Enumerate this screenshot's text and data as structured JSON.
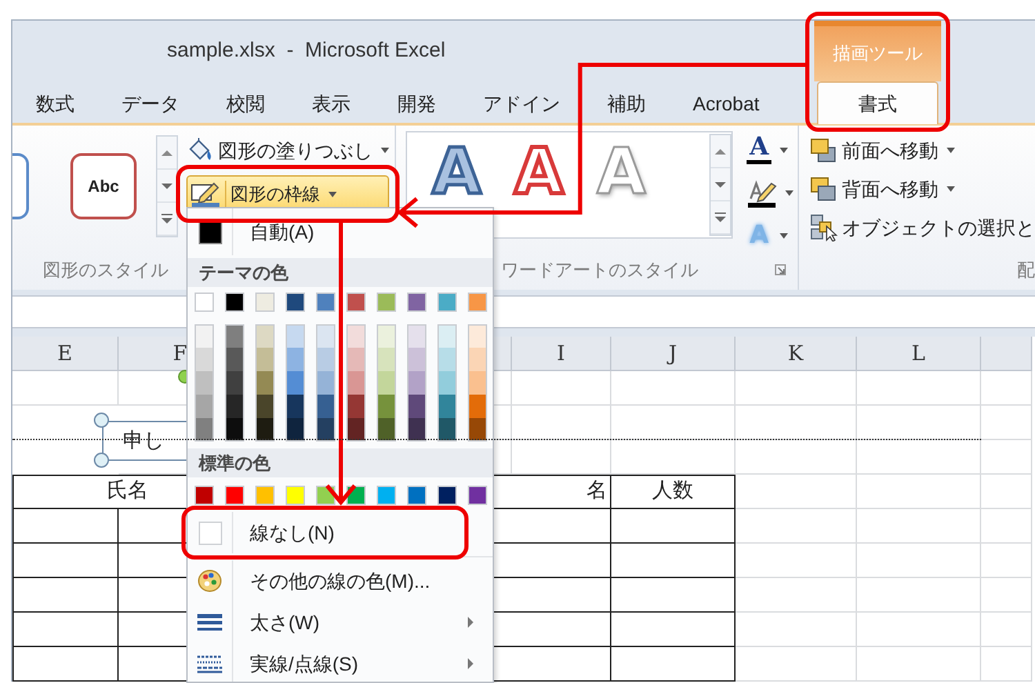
{
  "window": {
    "title": "sample.xlsx  -  Microsoft Excel"
  },
  "context_group": {
    "label": "描画ツール",
    "annotated": true
  },
  "tabs": [
    {
      "label": "数式",
      "selected": false,
      "kind": "standard"
    },
    {
      "label": "データ",
      "selected": false,
      "kind": "standard"
    },
    {
      "label": "校閲",
      "selected": false,
      "kind": "standard"
    },
    {
      "label": "表示",
      "selected": false,
      "kind": "standard"
    },
    {
      "label": "開発",
      "selected": false,
      "kind": "standard"
    },
    {
      "label": "アドイン",
      "selected": false,
      "kind": "standard"
    },
    {
      "label": "補助",
      "selected": false,
      "kind": "standard"
    },
    {
      "label": "Acrobat",
      "selected": false,
      "kind": "standard"
    },
    {
      "label": "書式",
      "selected": true,
      "kind": "contextual"
    }
  ],
  "ribbon": {
    "shape_styles": {
      "label": "図形のスタイル",
      "samples": [
        {
          "kind": "partial"
        },
        {
          "kind": "red",
          "text": "Abc"
        }
      ]
    },
    "shape_fill": {
      "label": "図形の塗りつぶし"
    },
    "shape_outline": {
      "label": "図形の枠線",
      "selected": true,
      "annotated": true
    },
    "wordart": {
      "label": "ワードアートのスタイル",
      "samples": [
        {
          "kind": "blue-outline",
          "text": "A"
        },
        {
          "kind": "red-outline",
          "text": "A"
        },
        {
          "kind": "white",
          "text": "A"
        }
      ],
      "text_fill": "A",
      "text_effects": "A"
    },
    "arrange": {
      "label": "配",
      "items": [
        {
          "kind": "front",
          "label": "前面へ移動",
          "dropdown": true
        },
        {
          "kind": "back",
          "label": "背面へ移動",
          "dropdown": true
        },
        {
          "kind": "select",
          "label": "オブジェクトの選択と",
          "dropdown": false
        }
      ]
    }
  },
  "sheet": {
    "columns": [
      {
        "label": "E"
      },
      {
        "label": "F"
      },
      {},
      {},
      {
        "label": "I"
      },
      {
        "label": "J"
      },
      {
        "label": "K"
      },
      {
        "label": "L"
      },
      {}
    ],
    "page_break": true,
    "table": {
      "headings": [
        {
          "text": "氏名"
        },
        {
          "text": "名"
        },
        {
          "text": "人数"
        }
      ]
    },
    "shape": {
      "text": "申し",
      "selected": true
    }
  },
  "menu": {
    "automatic": {
      "label": "自動(A)",
      "color": "#000000"
    },
    "theme_header": "テーマの色",
    "theme_colors": [
      {
        "color": "#ffffff",
        "shades": [
          {
            "color": "#f2f2f2"
          },
          {
            "color": "#d9d9d9"
          },
          {
            "color": "#bfbfbf"
          },
          {
            "color": "#a6a6a6"
          },
          {
            "color": "#808080"
          }
        ]
      },
      {
        "color": "#000000",
        "shades": [
          {
            "color": "#7f7f7f"
          },
          {
            "color": "#595959"
          },
          {
            "color": "#404040"
          },
          {
            "color": "#262626"
          },
          {
            "color": "#0d0d0d"
          }
        ]
      },
      {
        "color": "#eeece1",
        "shades": [
          {
            "color": "#ddd9c3"
          },
          {
            "color": "#c4bd97"
          },
          {
            "color": "#948a54"
          },
          {
            "color": "#4a452a"
          },
          {
            "color": "#1e1c11"
          }
        ]
      },
      {
        "color": "#1f497d",
        "shades": [
          {
            "color": "#c6d9f0"
          },
          {
            "color": "#8db3e2"
          },
          {
            "color": "#548dd4"
          },
          {
            "color": "#17365d"
          },
          {
            "color": "#0f243e"
          }
        ]
      },
      {
        "color": "#4f81bd",
        "shades": [
          {
            "color": "#dbe5f1"
          },
          {
            "color": "#b8cce4"
          },
          {
            "color": "#95b3d7"
          },
          {
            "color": "#366092"
          },
          {
            "color": "#244061"
          }
        ]
      },
      {
        "color": "#c0504d",
        "shades": [
          {
            "color": "#f2dcdb"
          },
          {
            "color": "#e5b9b7"
          },
          {
            "color": "#d99694"
          },
          {
            "color": "#953734"
          },
          {
            "color": "#632423"
          }
        ]
      },
      {
        "color": "#9bbb59",
        "shades": [
          {
            "color": "#ebf1dd"
          },
          {
            "color": "#d7e3bc"
          },
          {
            "color": "#c3d69b"
          },
          {
            "color": "#76923c"
          },
          {
            "color": "#4f6128"
          }
        ]
      },
      {
        "color": "#8064a2",
        "shades": [
          {
            "color": "#e5e0ec"
          },
          {
            "color": "#ccc1d9"
          },
          {
            "color": "#b2a2c7"
          },
          {
            "color": "#5f497a"
          },
          {
            "color": "#3f3151"
          }
        ]
      },
      {
        "color": "#4bacc6",
        "shades": [
          {
            "color": "#dbeef3"
          },
          {
            "color": "#b7dde8"
          },
          {
            "color": "#92cddc"
          },
          {
            "color": "#31859b"
          },
          {
            "color": "#205867"
          }
        ]
      },
      {
        "color": "#f79646",
        "shades": [
          {
            "color": "#fdeada"
          },
          {
            "color": "#fbd5b5"
          },
          {
            "color": "#fac08f"
          },
          {
            "color": "#e36c09"
          },
          {
            "color": "#974806"
          }
        ]
      }
    ],
    "standard_header": "標準の色",
    "standard_colors": [
      {
        "color": "#c00000"
      },
      {
        "color": "#ff0000"
      },
      {
        "color": "#ffc000"
      },
      {
        "color": "#ffff00"
      },
      {
        "color": "#92d050"
      },
      {
        "color": "#00b050"
      },
      {
        "color": "#00b0f0"
      },
      {
        "color": "#0070c0"
      },
      {
        "color": "#002060"
      },
      {
        "color": "#7030a0"
      }
    ],
    "commands": [
      {
        "kind": "none",
        "label": "線なし(N)",
        "submenu": false,
        "annotated": true
      },
      {
        "kind": "palette",
        "label": "その他の線の色(M)...",
        "submenu": false,
        "annotated": false
      },
      {
        "kind": "weight",
        "label": "太さ(W)",
        "submenu": true,
        "annotated": false
      },
      {
        "kind": "dash",
        "label": "実線/点線(S)",
        "submenu": true,
        "annotated": false
      }
    ]
  },
  "callouts": [
    {
      "kind": "elbow"
    },
    {
      "kind": "down"
    }
  ]
}
